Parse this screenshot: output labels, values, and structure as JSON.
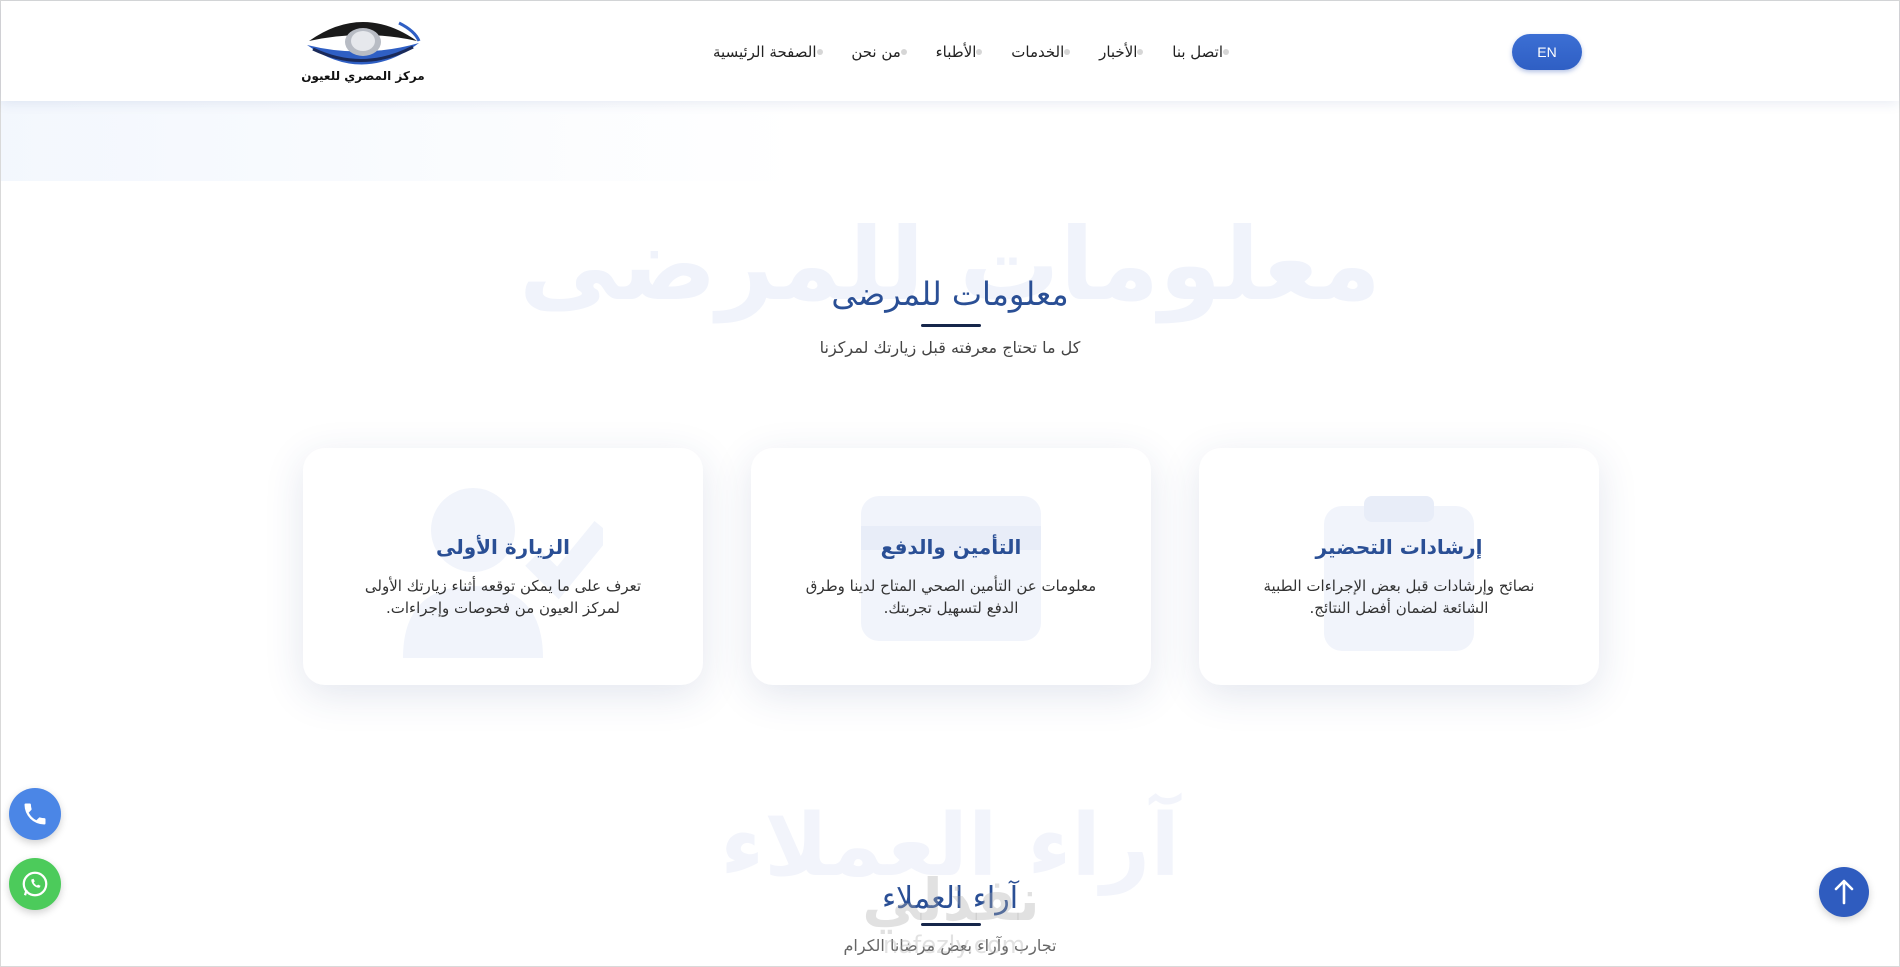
{
  "header": {
    "logo_text": "مركز المصري للعيون",
    "nav": [
      "الصفحة الرئيسية",
      "من نحن",
      "الأطباء",
      "الخدمات",
      "الأخبار",
      "اتصل بنا"
    ],
    "lang_button": "EN"
  },
  "info_section": {
    "watermark": "معلومات للمرضى",
    "title": "معلومات للمرضى",
    "subtitle": "كل ما تحتاج معرفته قبل زيارتك لمركزنا",
    "cards": [
      {
        "title": "الزيارة الأولى",
        "text": "تعرف على ما يمكن توقعه أثناء زيارتك الأولى لمركز العيون من فحوصات وإجراءات.",
        "icon": "user-check-icon"
      },
      {
        "title": "التأمين والدفع",
        "text": "معلومات عن التأمين الصحي المتاح لدينا وطرق الدفع لتسهيل تجربتك.",
        "icon": "credit-card-icon"
      },
      {
        "title": "إرشادات التحضير",
        "text": "نصائح وإرشادات قبل بعض الإجراءات الطبية الشائعة لضمان أفضل النتائج.",
        "icon": "clipboard-icon"
      }
    ]
  },
  "testimonials_section": {
    "watermark": "آراء العملاء",
    "title": "آراء العملاء",
    "subtitle": "تجارب وآراء بعض مرضانا الكرام"
  },
  "overlay_watermark": {
    "line1": "نفذلي",
    "line2": "nafezly.com"
  },
  "colors": {
    "accent": "#2a4f95",
    "button": "#2f5fc4",
    "phone": "#4b86e6",
    "whatsapp": "#4ccb5b"
  }
}
